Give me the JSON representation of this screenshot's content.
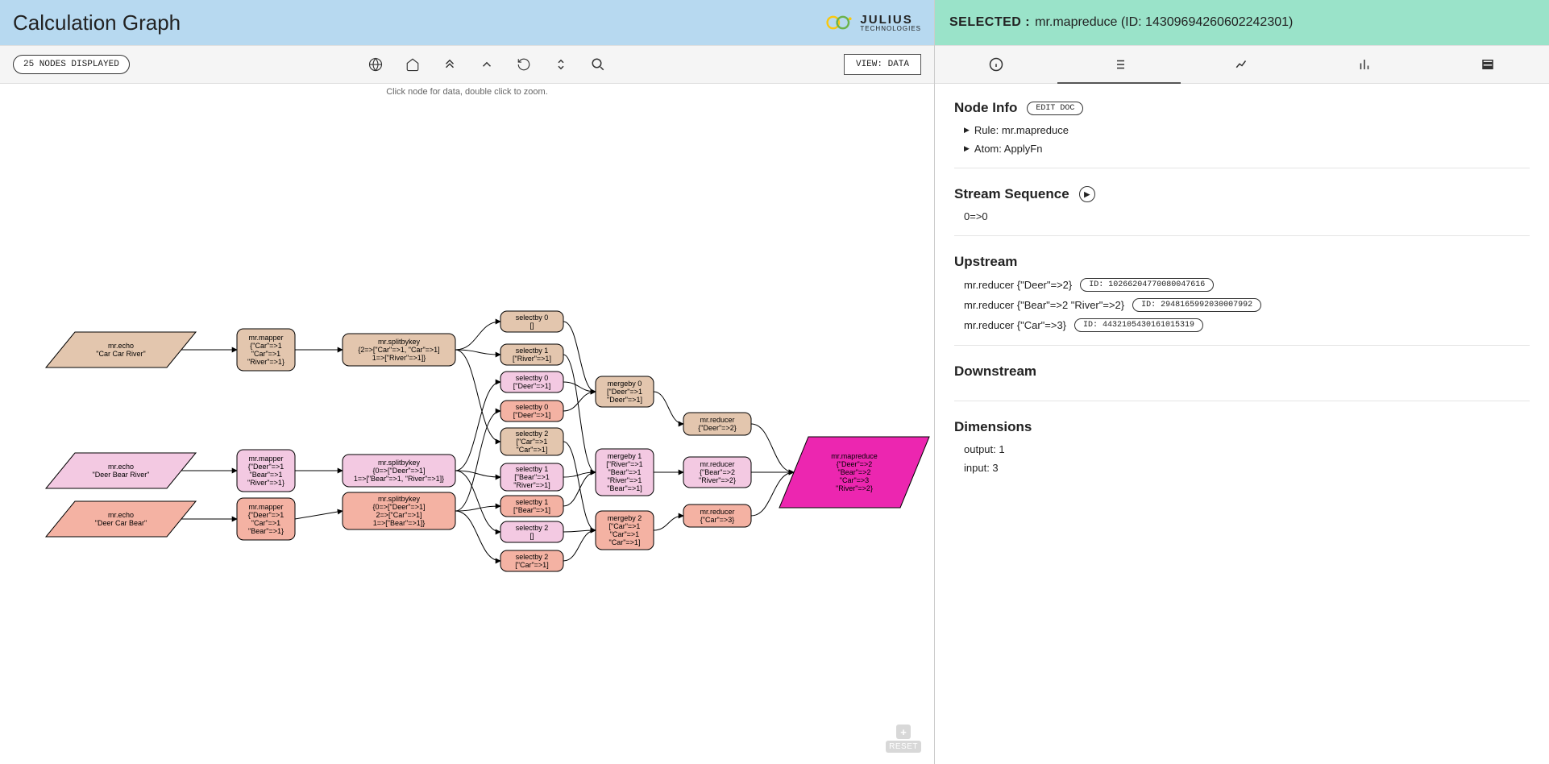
{
  "header": {
    "title": "Calculation Graph",
    "logo_main": "JULIUS",
    "logo_sub": "TECHNOLOGIES"
  },
  "toolbar": {
    "nodes_displayed": "25 NODES DISPLAYED",
    "view_button": "VIEW: DATA",
    "hint": "Click node for data, double click to zoom."
  },
  "graph": {
    "echo": [
      {
        "title": "mr.echo",
        "val": "\"Car Car River\""
      },
      {
        "title": "mr.echo",
        "val": "\"Deer Bear River\""
      },
      {
        "title": "mr.echo",
        "val": "\"Deer Car Bear\""
      }
    ],
    "mapper": [
      {
        "title": "mr.mapper",
        "l1": "{\"Car\"=>1",
        "l2": "\"Car\"=>1",
        "l3": "\"River\"=>1}"
      },
      {
        "title": "mr.mapper",
        "l1": "{\"Deer\"=>1",
        "l2": "\"Bear\"=>1",
        "l3": "\"River\"=>1}"
      },
      {
        "title": "mr.mapper",
        "l1": "{\"Deer\"=>1",
        "l2": "\"Car\"=>1",
        "l3": "\"Bear\"=>1}"
      }
    ],
    "split": [
      {
        "title": "mr.splitbykey",
        "l1": "{2=>[\"Car\"=>1, \"Car\"=>1]",
        "l2": "1=>[\"River\"=>1]}"
      },
      {
        "title": "mr.splitbykey",
        "l1": "{0=>[\"Deer\"=>1]",
        "l2": "1=>[\"Bear\"=>1, \"River\"=>1]}"
      },
      {
        "title": "mr.splitbykey",
        "l1": "{0=>[\"Deer\"=>1]",
        "l2": "2=>[\"Car\"=>1]",
        "l3": "1=>[\"Bear\"=>1]}"
      }
    ],
    "select": [
      {
        "title": "selectby 0",
        "val": "[]"
      },
      {
        "title": "selectby 1",
        "val": "[\"River\"=>1]"
      },
      {
        "title": "selectby 0",
        "val": "[\"Deer\"=>1]"
      },
      {
        "title": "selectby 0",
        "val": "[\"Deer\"=>1]"
      },
      {
        "title": "selectby 2",
        "l1": "[\"Car\"=>1",
        "l2": "\"Car\"=>1]"
      },
      {
        "title": "selectby 1",
        "l1": "[\"Bear\"=>1",
        "l2": "\"River\"=>1]"
      },
      {
        "title": "selectby 1",
        "val": "[\"Bear\"=>1]"
      },
      {
        "title": "selectby 2",
        "val": "[]"
      },
      {
        "title": "selectby 2",
        "val": "[\"Car\"=>1]"
      }
    ],
    "merge": [
      {
        "title": "mergeby 0",
        "l1": "[\"Deer\"=>1",
        "l2": "\"Deer\"=>1]"
      },
      {
        "title": "mergeby 1",
        "l1": "[\"River\"=>1",
        "l2": "\"Bear\"=>1",
        "l3": "\"River\"=>1",
        "l4": "\"Bear\"=>1]"
      },
      {
        "title": "mergeby 2",
        "l1": "[\"Car\"=>1",
        "l2": "\"Car\"=>1",
        "l3": "\"Car\"=>1]"
      }
    ],
    "reducer": [
      {
        "title": "mr.reducer",
        "val": "{\"Deer\"=>2}"
      },
      {
        "title": "mr.reducer",
        "l1": "{\"Bear\"=>2",
        "l2": "\"River\"=>2}"
      },
      {
        "title": "mr.reducer",
        "val": "{\"Car\"=>3}"
      }
    ],
    "final": {
      "title": "mr.mapreduce",
      "l1": "{\"Deer\"=>2",
      "l2": "\"Bear\"=>2",
      "l3": "\"Car\"=>3",
      "l4": "\"River\"=>2}"
    }
  },
  "zoom": {
    "plus": "+",
    "reset": "RESET"
  },
  "selected": {
    "label": "SELECTED :",
    "value": "mr.mapreduce (ID: 14309694260602242301)"
  },
  "node_info": {
    "title": "Node Info",
    "edit_doc": "EDIT DOC",
    "rule": "Rule: mr.mapreduce",
    "atom": "Atom: ApplyFn"
  },
  "stream": {
    "title": "Stream Sequence",
    "value": "0=>0"
  },
  "upstream": {
    "title": "Upstream",
    "items": [
      {
        "label": "mr.reducer {\"Deer\"=>2}",
        "id": "ID: 10266204770080047616"
      },
      {
        "label": "mr.reducer {\"Bear\"=>2 \"River\"=>2}",
        "id": "ID: 2948165992030007992"
      },
      {
        "label": "mr.reducer {\"Car\"=>3}",
        "id": "ID: 4432105430161015319"
      }
    ]
  },
  "downstream": {
    "title": "Downstream"
  },
  "dimensions": {
    "title": "Dimensions",
    "output": "output: 1",
    "input": "input: 3"
  }
}
